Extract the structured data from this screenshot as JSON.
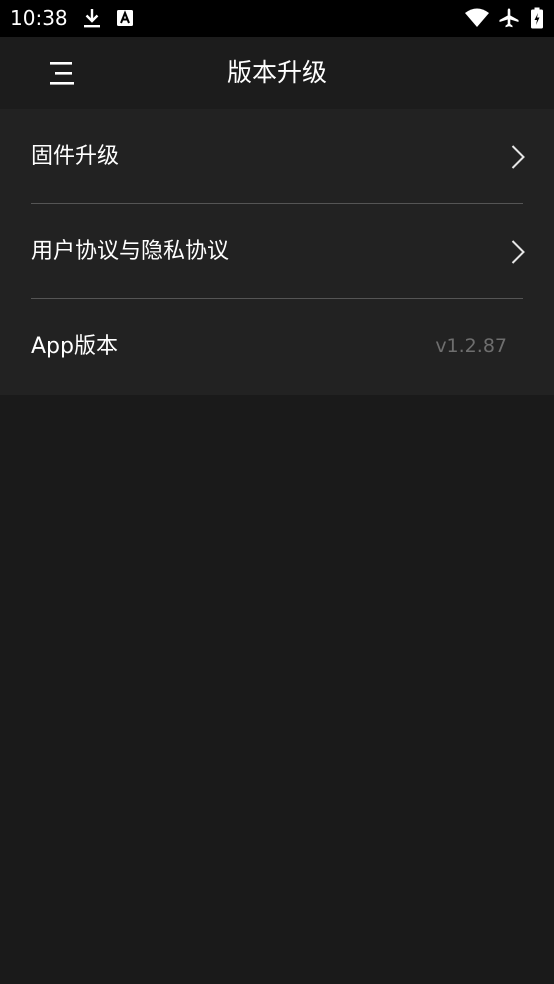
{
  "status_bar": {
    "time": "10:38",
    "icons": [
      "download-icon",
      "font-notification-icon",
      "wifi-icon",
      "airplane-mode-icon",
      "battery-icon"
    ]
  },
  "header": {
    "title": "版本升级",
    "menu_icon": "menu-icon"
  },
  "settings": {
    "items": [
      {
        "label": "固件升级",
        "trailing": "chevron-right-icon"
      },
      {
        "label": "用户协议与隐私协议",
        "trailing": "chevron-right-icon"
      },
      {
        "label": "App版本",
        "value": "v1.2.87"
      }
    ]
  },
  "colors": {
    "status_bar_bg": "#000000",
    "app_bar_bg": "#1c1c1c",
    "list_bg": "#222222",
    "page_bg": "#1a1a1a",
    "divider": "#555555",
    "text_primary": "#ffffff",
    "text_secondary": "#6e6e6e"
  }
}
